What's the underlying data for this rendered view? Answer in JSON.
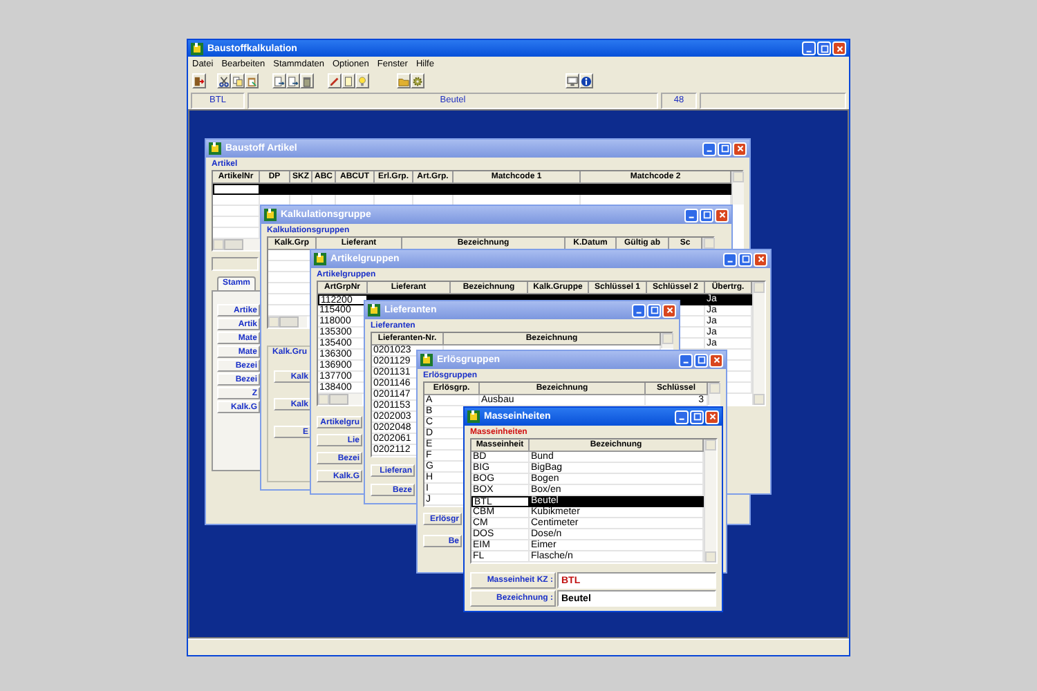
{
  "window": {
    "title": "Baustoffkalkulation"
  },
  "menu": [
    "Datei",
    "Bearbeiten",
    "Stammdaten",
    "Optionen",
    "Fenster",
    "Hilfe"
  ],
  "info_bar": [
    "BTL",
    "Beutel",
    "48"
  ],
  "child_windows": [
    {
      "title": "Baustoff Artikel",
      "active": false,
      "group_label": "Artikel",
      "columns": [
        "ArtikelNr",
        "DP",
        "SKZ",
        "ABC",
        "ABCUT",
        "Erl.Grp.",
        "Art.Grp.",
        "Matchcode 1",
        "Matchcode 2"
      ],
      "rows": [
        {
          "selected": true
        }
      ],
      "tab_label": "Stamm",
      "fields": [
        {
          "label": "Artike"
        },
        {
          "label": "Artik"
        },
        {
          "label": "Mate"
        },
        {
          "label": "Mate"
        },
        {
          "label": "Bezei"
        },
        {
          "label": "Bezei"
        },
        {
          "label": "Z"
        },
        {
          "label": "Kalk.G"
        }
      ]
    },
    {
      "title": "Kalkulationsgruppe",
      "active": false,
      "group_label": "Kalkulationsgruppen",
      "columns": [
        "Kalk.Grp",
        "Lieferant",
        "Bezeichnung",
        "K.Datum",
        "Gültig ab",
        "Sc"
      ],
      "form_title": "Kalk.Gru",
      "fields": [
        {
          "label": "Kalk"
        },
        {
          "label": "Kalk"
        },
        {
          "label": "E"
        }
      ]
    },
    {
      "title": "Artikelgruppen",
      "active": false,
      "group_label": "Artikelgruppen",
      "columns": [
        "ArtGrpNr",
        "Lieferant",
        "Bezeichnung",
        "Kalk.Gruppe",
        "Schlüssel 1",
        "Schlüssel 2",
        "Übertrg."
      ],
      "rows": [
        {
          "selected": true,
          "cells": [
            "112200"
          ],
          "end_cell": "Ja"
        },
        {
          "selected": false,
          "cells": [
            "115400"
          ],
          "end_cell": "Ja"
        },
        {
          "selected": false,
          "cells": [
            "118000"
          ],
          "end_cell": "Ja"
        },
        {
          "selected": false,
          "cells": [
            "135300"
          ],
          "end_cell": "Ja"
        },
        {
          "selected": false,
          "cells": [
            "135400"
          ],
          "end_cell": "Ja"
        },
        {
          "selected": false,
          "cells": [
            "136300"
          ]
        },
        {
          "selected": false,
          "cells": [
            "136900"
          ]
        },
        {
          "selected": false,
          "cells": [
            "137700"
          ]
        },
        {
          "selected": false,
          "cells": [
            "138400"
          ]
        }
      ],
      "fields": [
        {
          "label": "Artikelgru"
        },
        {
          "label": "Lie"
        },
        {
          "label": "Bezei"
        },
        {
          "label": "Kalk.G"
        }
      ]
    },
    {
      "title": "Lieferanten",
      "active": false,
      "group_label": "Lieferanten",
      "columns": [
        "Lieferanten-Nr.",
        "Bezeichnung"
      ],
      "rows": [
        {
          "selected": false,
          "cells": [
            "0201023"
          ]
        },
        {
          "selected": false,
          "cells": [
            "0201129"
          ]
        },
        {
          "selected": false,
          "cells": [
            "0201131"
          ]
        },
        {
          "selected": false,
          "cells": [
            "0201146"
          ]
        },
        {
          "selected": false,
          "cells": [
            "0201147"
          ]
        },
        {
          "selected": false,
          "cells": [
            "0201153"
          ]
        },
        {
          "selected": false,
          "cells": [
            "0202003"
          ]
        },
        {
          "selected": false,
          "cells": [
            "0202048"
          ]
        },
        {
          "selected": false,
          "cells": [
            "0202061"
          ]
        },
        {
          "selected": false,
          "cells": [
            "0202112"
          ]
        }
      ],
      "fields": [
        {
          "label": "Lieferan"
        },
        {
          "label": "Beze"
        }
      ]
    },
    {
      "title": "Erlösgruppen",
      "active": false,
      "group_label": "Erlösgruppen",
      "columns": [
        "Erlösgrp.",
        "Bezeichnung",
        "Schlüssel"
      ],
      "rows": [
        {
          "selected": false,
          "cells": [
            "A",
            "Ausbau",
            "3"
          ]
        },
        {
          "selected": false,
          "cells": [
            "B"
          ]
        },
        {
          "selected": false,
          "cells": [
            "C"
          ]
        },
        {
          "selected": false,
          "cells": [
            "D"
          ]
        },
        {
          "selected": false,
          "cells": [
            "E"
          ]
        },
        {
          "selected": false,
          "cells": [
            "F"
          ]
        },
        {
          "selected": false,
          "cells": [
            "G"
          ]
        },
        {
          "selected": false,
          "cells": [
            "H"
          ]
        },
        {
          "selected": false,
          "cells": [
            "I"
          ]
        },
        {
          "selected": false,
          "cells": [
            "J"
          ]
        }
      ],
      "fields": [
        {
          "label": "Erlösgr"
        },
        {
          "label": "Be"
        }
      ]
    },
    {
      "title": "Masseinheiten",
      "active": true,
      "group_label": "Masseinheiten",
      "columns": [
        "Masseinheit",
        "Bezeichnung"
      ],
      "rows": [
        {
          "selected": false,
          "cells": [
            "BD",
            "Bund"
          ]
        },
        {
          "selected": false,
          "cells": [
            "BIG",
            "BigBag"
          ]
        },
        {
          "selected": false,
          "cells": [
            "BOG",
            "Bogen"
          ]
        },
        {
          "selected": false,
          "cells": [
            "BOX",
            "Box/en"
          ]
        },
        {
          "selected": true,
          "cells": [
            "BTL",
            "Beutel"
          ]
        },
        {
          "selected": false,
          "cells": [
            "CBM",
            "Kubikmeter"
          ]
        },
        {
          "selected": false,
          "cells": [
            "CM",
            "Centimeter"
          ]
        },
        {
          "selected": false,
          "cells": [
            "DOS",
            "Dose/n"
          ]
        },
        {
          "selected": false,
          "cells": [
            "EIM",
            "Eimer"
          ]
        },
        {
          "selected": false,
          "cells": [
            "FL",
            "Flasche/n"
          ]
        }
      ],
      "fields": [
        {
          "label": "Masseinheit KZ :",
          "value": "BTL",
          "kind": "key"
        },
        {
          "label": "Bezeichnung :",
          "value": "Beutel",
          "kind": "text"
        }
      ]
    }
  ]
}
